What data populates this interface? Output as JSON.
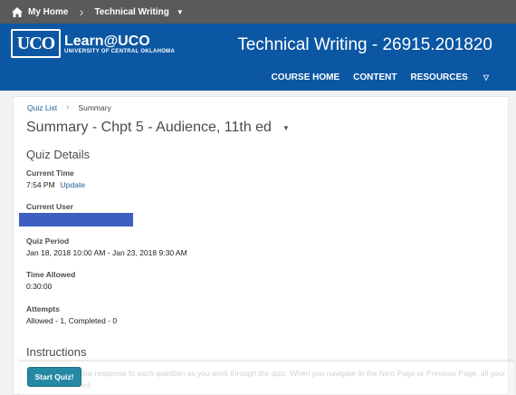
{
  "topbar": {
    "home_label": "My Home",
    "course_label": "Technical Writing"
  },
  "header": {
    "logo_mark": "UCO",
    "logo_name": "Learn@UCO",
    "logo_sub": "UNIVERSITY OF CENTRAL OKLAHOMA",
    "course_title": "Technical Writing - 26915.201820",
    "nav": [
      "COURSE HOME",
      "CONTENT",
      "RESOURCES"
    ]
  },
  "breadcrumb": {
    "parent": "Quiz List",
    "current": "Summary"
  },
  "page_title": "Summary - Chpt 5 - Audience, 11th ed",
  "quiz_details": {
    "heading": "Quiz Details",
    "current_time_label": "Current Time",
    "current_time_value": "7:54 PM",
    "update_link": "Update",
    "current_user_label": "Current User",
    "quiz_period_label": "Quiz Period",
    "quiz_period_value": "Jan 18, 2018 10:00 AM - Jan 23, 2018 9:30 AM",
    "time_allowed_label": "Time Allowed",
    "time_allowed_value": "0:30:00",
    "attempts_label": "Attempts",
    "attempts_value": "Allowed - 1, Completed - 0"
  },
  "instructions": {
    "heading": "Instructions",
    "text_line1": "our response to each question as you work through the quiz. When you navigate to the Next Page or Previous Page, all your",
    "text_line2": "ed."
  },
  "start_button": "Start Quiz!",
  "colors": {
    "header_blue": "#0b57a3",
    "topbar_gray": "#5a5a5a",
    "button_teal": "#2589a3",
    "redaction_blue": "#3d5fbf"
  }
}
